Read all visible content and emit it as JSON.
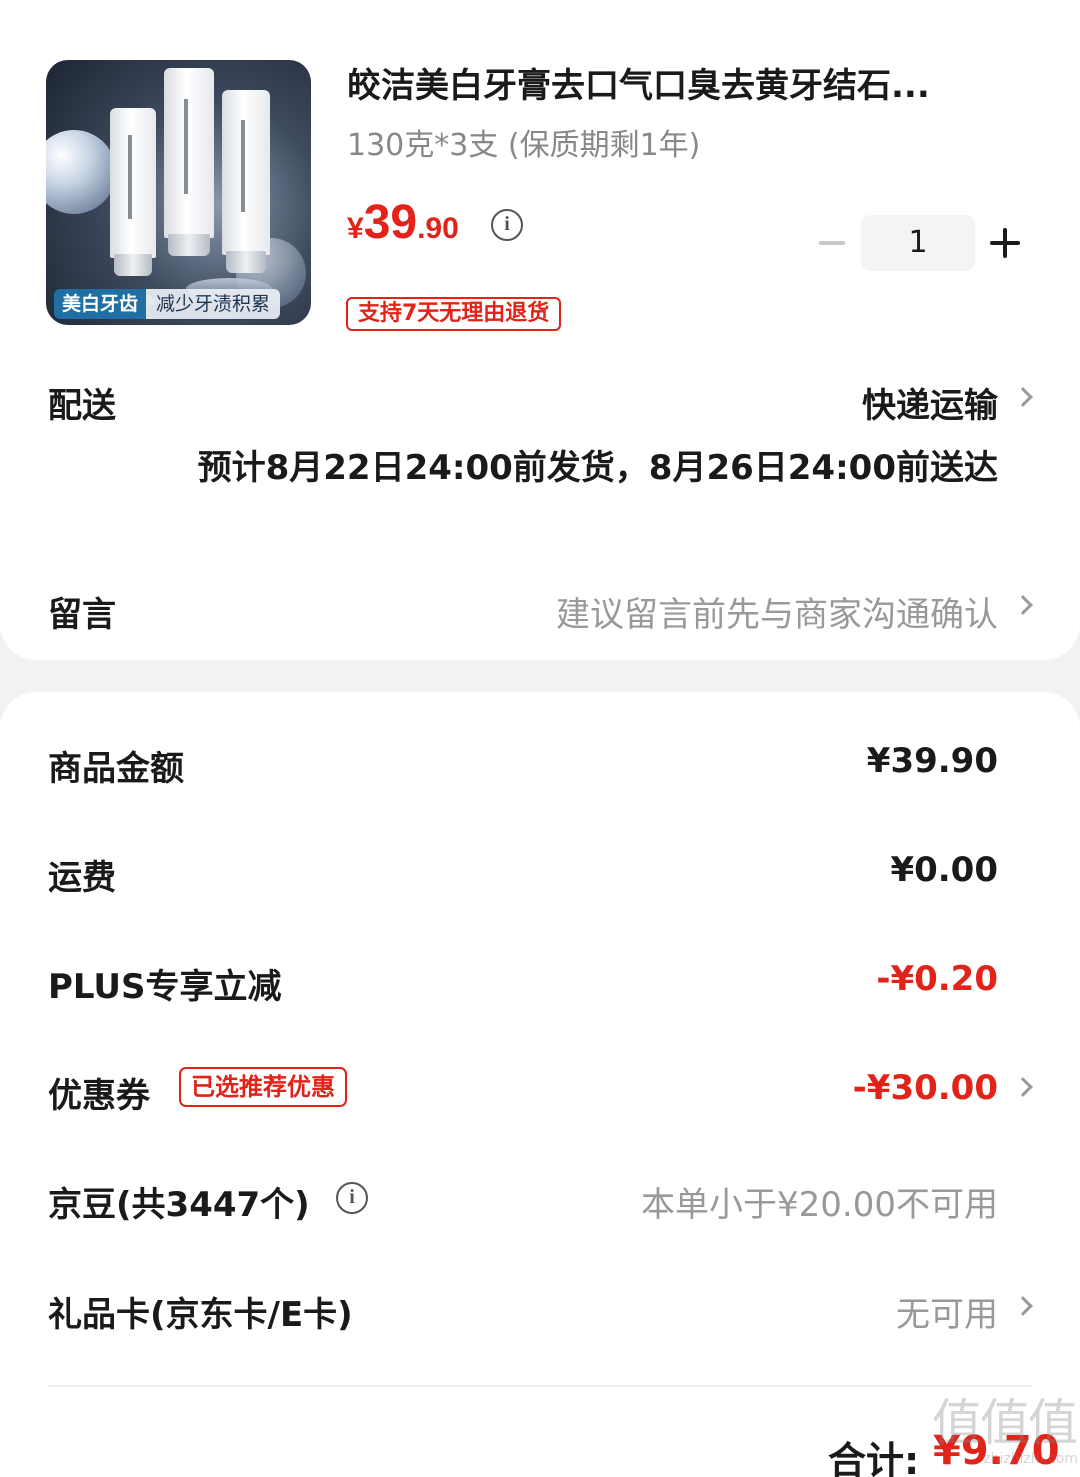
{
  "product": {
    "title": "皎洁美白牙膏去口气口臭去黄牙结石...",
    "spec": "130克*3支 (保质期剩1年)",
    "image_tag_primary": "美白牙齿",
    "image_tag_secondary": "减少牙渍积累",
    "price_currency": "¥",
    "price_integer": "39",
    "price_decimal": ".90",
    "info_icon": "i",
    "quantity": "1",
    "return_badge": "支持7天无理由退货"
  },
  "delivery": {
    "label": "配送",
    "method": "快递运输",
    "estimate": "预计8月22日24:00前发货，8月26日24:00前送达"
  },
  "message": {
    "label": "留言",
    "placeholder": "建议留言前先与商家沟通确认"
  },
  "summary": {
    "goods_label": "商品金额",
    "goods_value": "¥39.90",
    "shipping_label": "运费",
    "shipping_value": "¥0.00",
    "plus_label": "PLUS专享立减",
    "plus_value": "-¥0.20",
    "coupon_label": "优惠券",
    "coupon_badge": "已选推荐优惠",
    "coupon_value": "-¥30.00",
    "beans_label": "京豆(共3447个)",
    "beans_info_icon": "i",
    "beans_value": "本单小于¥20.00不可用",
    "giftcard_label": "礼品卡(京东卡/E卡)",
    "giftcard_value": "无可用"
  },
  "total": {
    "label": "合计:",
    "amount": "¥9.70"
  },
  "watermark": {
    "main": "值值值",
    "sub": "zhizhizhi.com"
  },
  "colors": {
    "accent_red": "#e2231a",
    "text_gray": "#999999",
    "background": "#f2f2f2"
  }
}
